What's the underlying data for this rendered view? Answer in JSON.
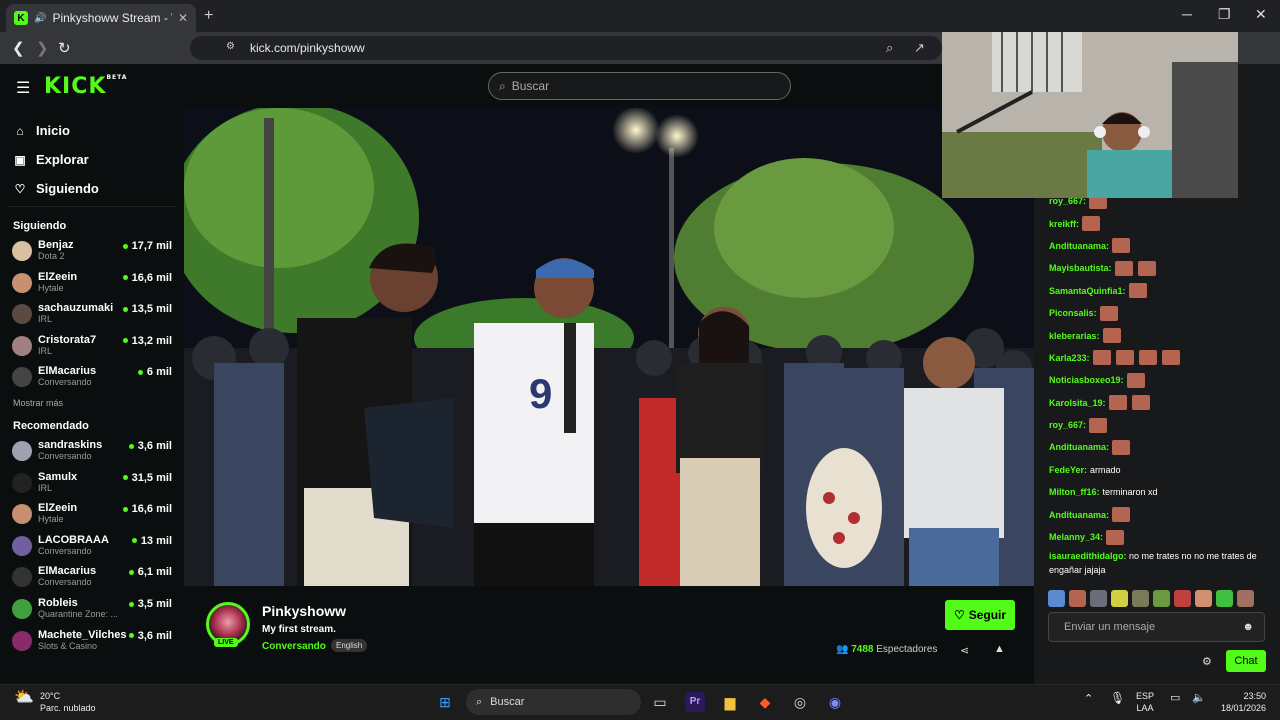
{
  "browser": {
    "tab_title": "Pinkyshoww Stream - Watch",
    "url": "kick.com/pinkyshoww"
  },
  "kick": {
    "logo": "KICK",
    "logo_tag": "BETA",
    "search_placeholder": "Buscar"
  },
  "sidebar": {
    "nav": [
      {
        "label": "Inicio",
        "icon": "home-icon"
      },
      {
        "label": "Explorar",
        "icon": "compass-icon"
      },
      {
        "label": "Siguiendo",
        "icon": "heart-icon"
      }
    ],
    "following_heading": "Siguiendo",
    "following": [
      {
        "name": "Benjaz",
        "category": "Dota 2",
        "viewers": "17,7 mil"
      },
      {
        "name": "ElZeein",
        "category": "Hytale",
        "viewers": "16,6 mil"
      },
      {
        "name": "sachauzumaki",
        "category": "IRL",
        "viewers": "13,5 mil"
      },
      {
        "name": "Cristorata7",
        "category": "IRL",
        "viewers": "13,2 mil"
      },
      {
        "name": "ElMacarius",
        "category": "Conversando",
        "viewers": "6 mil"
      }
    ],
    "show_more": "Mostrar más",
    "recommended_heading": "Recomendado",
    "recommended": [
      {
        "name": "sandraskins",
        "category": "Conversando",
        "viewers": "3,6 mil"
      },
      {
        "name": "Samulx",
        "category": "IRL",
        "viewers": "31,5 mil"
      },
      {
        "name": "ElZeein",
        "category": "Hytale",
        "viewers": "16,6 mil"
      },
      {
        "name": "LACOBRAAA",
        "category": "Conversando",
        "viewers": "13 mil"
      },
      {
        "name": "ElMacarius",
        "category": "Conversando",
        "viewers": "6,1 mil"
      },
      {
        "name": "Robleis",
        "category": "Quarantine Zone: ...",
        "viewers": "3,5 mil"
      },
      {
        "name": "Machete_Vilches",
        "category": "Slots & Casino",
        "viewers": "3,6 mil"
      }
    ]
  },
  "stream": {
    "channel": "Pinkyshoww",
    "title": "My first stream.",
    "category": "Conversando",
    "language": "English",
    "live_badge": "LIVE",
    "follow_label": "Seguir",
    "viewer_count": "7488",
    "viewer_label": "Espectadores"
  },
  "chat": {
    "messages": [
      {
        "user": "roy_667:",
        "text": "",
        "emotes": 1
      },
      {
        "user": "kreikff:",
        "text": "",
        "emotes": 1
      },
      {
        "user": "Anditu​anama:",
        "text": "",
        "emotes": 1
      },
      {
        "user": "Mayisbautista:",
        "text": "",
        "emotes": 2
      },
      {
        "user": "SamantaQuinfia1:",
        "text": "",
        "emotes": 1
      },
      {
        "user": "Piconsalis:",
        "text": "",
        "emotes": 1
      },
      {
        "user": "kleberarias:",
        "text": "",
        "emotes": 1
      },
      {
        "user": "Karla233:",
        "text": "",
        "emotes": 4
      },
      {
        "user": "Noticiasboxeo19:",
        "text": "",
        "emotes": 1
      },
      {
        "user": "Karolsita_19:",
        "text": "",
        "emotes": 2
      },
      {
        "user": "roy_667:",
        "text": "",
        "emotes": 1
      },
      {
        "user": "Andituanama:",
        "text": "",
        "emotes": 1
      },
      {
        "user": "FedeYer:",
        "text": "armado",
        "emotes": 0
      },
      {
        "user": "Milton_ff16:",
        "text": "terminaron xd",
        "emotes": 0
      },
      {
        "user": "Andituanama:",
        "text": "",
        "emotes": 1
      },
      {
        "user": "Melanny_34:",
        "text": "",
        "emotes": 1
      },
      {
        "user": "isauraedithidalgo:",
        "text": "no me trates no no me trates de engañar jajaja",
        "emotes": 0
      }
    ],
    "input_placeholder": "Enviar un mensaje",
    "chat_button": "Chat"
  },
  "taskbar": {
    "temp": "20°C",
    "weather": "Parc. nublado",
    "search": "Buscar",
    "lang": "ESP",
    "lang2": "LAA",
    "time": "23:50",
    "date": "18/01/2026"
  },
  "colors": {
    "accent": "#53fc18",
    "bg": "#0b0e0f",
    "chat_bg": "#18191b"
  }
}
